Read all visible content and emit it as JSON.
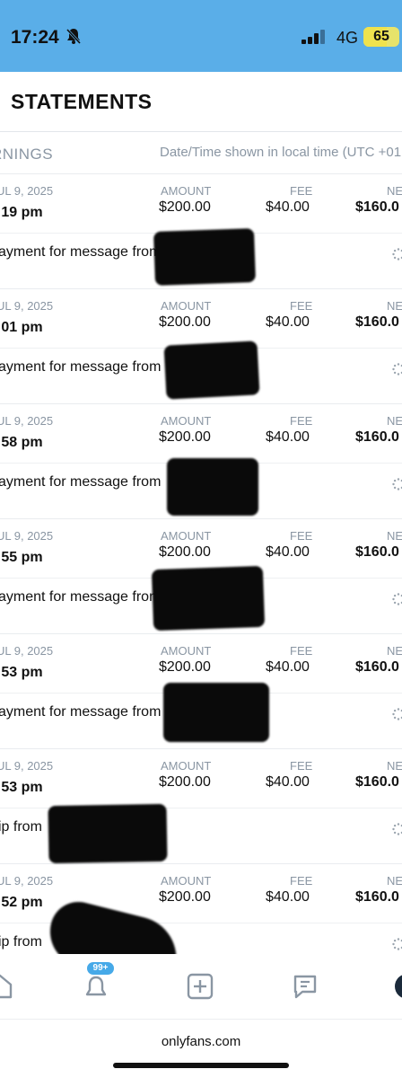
{
  "status_bar": {
    "time": "17:24",
    "network": "4G",
    "battery": "65",
    "battery_level": 0.65,
    "icons": [
      "bell-off-icon",
      "signal-icon"
    ]
  },
  "page": {
    "title": "STATEMENTS",
    "section": "RNINGS",
    "timezone_note": "Date/Time shown in local time (UTC +01"
  },
  "columns": {
    "amount": "AMOUNT",
    "fee": "FEE",
    "net": "NE"
  },
  "rows": [
    {
      "date": "UL 9, 2025",
      "time": ":19 pm",
      "amount": "$200.00",
      "fee": "$40.00",
      "net": "$160.0",
      "desc": "ayment for message from"
    },
    {
      "date": "UL 9, 2025",
      "time": ":01 pm",
      "amount": "$200.00",
      "fee": "$40.00",
      "net": "$160.0",
      "desc": "ayment for message from"
    },
    {
      "date": "UL 9, 2025",
      "time": ":58 pm",
      "amount": "$200.00",
      "fee": "$40.00",
      "net": "$160.0",
      "desc": "ayment for message from"
    },
    {
      "date": "UL 9, 2025",
      "time": ":55 pm",
      "amount": "$200.00",
      "fee": "$40.00",
      "net": "$160.0",
      "desc": "ayment for message from"
    },
    {
      "date": "UL 9, 2025",
      "time": ":53 pm",
      "amount": "$200.00",
      "fee": "$40.00",
      "net": "$160.0",
      "desc": "ayment for message from"
    },
    {
      "date": "UL 9, 2025",
      "time": ":53 pm",
      "amount": "$200.00",
      "fee": "$40.00",
      "net": "$160.0",
      "desc": "ip from"
    },
    {
      "date": "UL 9, 2025",
      "time": ":52 pm",
      "amount": "$200.00",
      "fee": "$40.00",
      "net": "$160.0",
      "desc": "ip from"
    }
  ],
  "bottom_nav": {
    "badge": "99+",
    "icons": [
      "home-icon",
      "bell-icon",
      "add-post-icon",
      "messages-icon",
      "profile-avatar"
    ]
  },
  "browser": {
    "domain": "onlyfans.com"
  },
  "colors": {
    "status_bar": "#5aaee8",
    "accent": "#46a9e8",
    "muted": "#8a96a3",
    "battery": "#e7e36b"
  }
}
